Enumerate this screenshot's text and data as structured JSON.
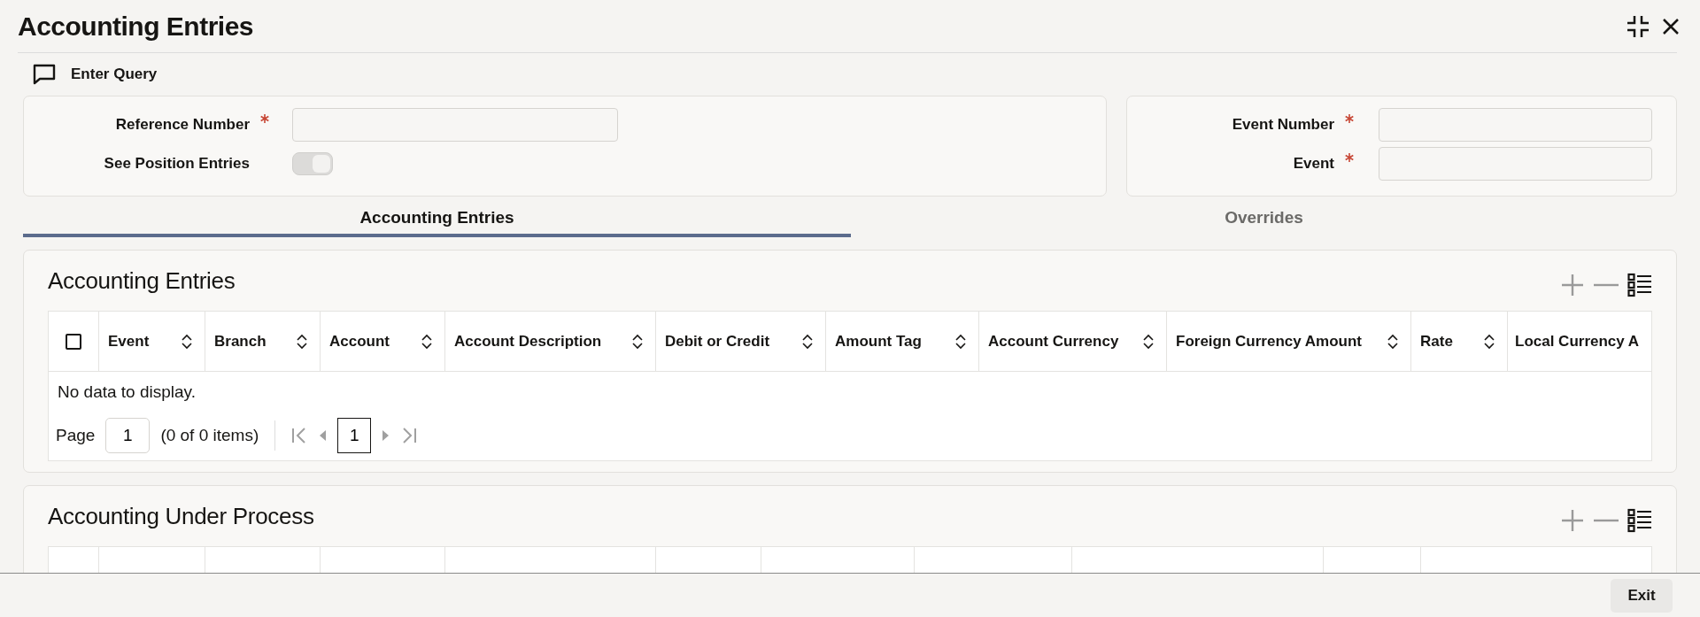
{
  "title": "Accounting Entries",
  "toolbar": {
    "enter_query": "Enter Query"
  },
  "form_left": {
    "fields": [
      {
        "kind": "text",
        "label": "Reference Number",
        "required": true
      },
      {
        "kind": "toggle",
        "label": "See Position Entries",
        "on": true,
        "disabled": true
      }
    ]
  },
  "form_right": {
    "fields": [
      {
        "kind": "text",
        "label": "Event Number",
        "required": true
      },
      {
        "kind": "text",
        "label": "Event",
        "required": true
      }
    ]
  },
  "tabs": [
    {
      "label": "Accounting Entries",
      "selected": true
    },
    {
      "label": "Overrides",
      "selected": false
    }
  ],
  "sections": [
    {
      "title": "Accounting Entries",
      "select_all_checked": false,
      "columns": [
        "Event",
        "Branch",
        "Account",
        "Account Description",
        "Debit or Credit",
        "Amount Tag",
        "Account Currency",
        "Foreign Currency Amount",
        "Rate",
        "Local Currency A"
      ],
      "empty_message": "No data to display.",
      "pagination": {
        "page_label": "Page",
        "page": "1",
        "summary": "(0 of 0 items)",
        "current": "1"
      }
    },
    {
      "title": "Accounting Under Process"
    }
  ],
  "footer": {
    "buttons": [
      "Exit"
    ]
  }
}
